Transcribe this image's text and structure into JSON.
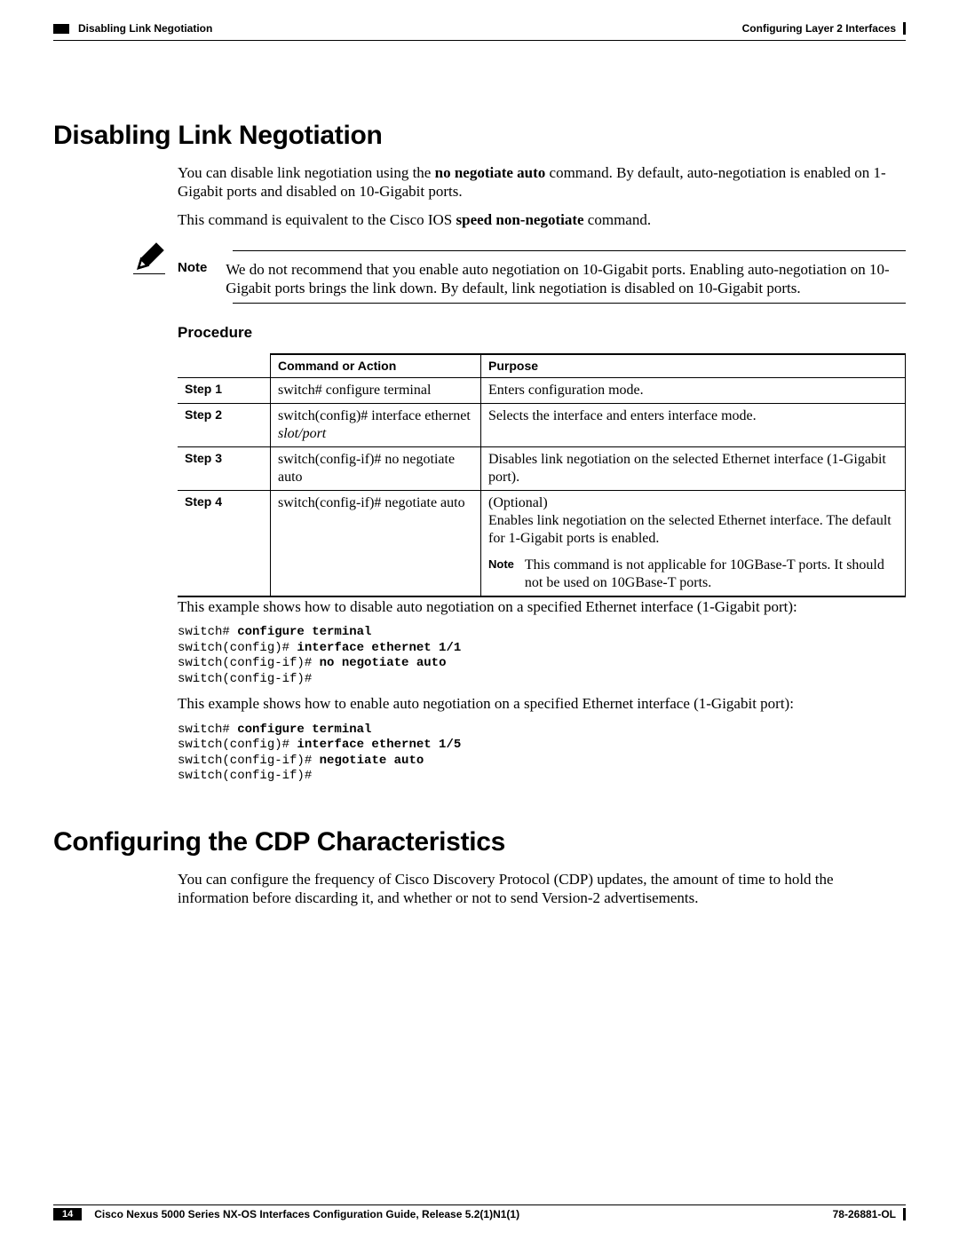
{
  "header": {
    "left_text": "Disabling Link Negotiation",
    "right_text": "Configuring Layer 2 Interfaces"
  },
  "section1": {
    "title": "Disabling Link Negotiation",
    "para1a": "You can disable link negotiation using the ",
    "para1b": "no negotiate auto",
    "para1c": " command. By default, auto-negotiation is enabled on 1-Gigabit ports and disabled on 10-Gigabit ports.",
    "para2a": "This command is equivalent to the Cisco IOS ",
    "para2b": "speed non-negotiate",
    "para2c": " command.",
    "note_label": "Note",
    "note_text": "We do not recommend that you enable auto negotiation on 10-Gigabit ports. Enabling auto-negotiation on 10-Gigabit ports brings the link down. By default, link negotiation is disabled on 10-Gigabit ports.",
    "procedure_head": "Procedure",
    "table": {
      "h1": "",
      "h2": "Command or Action",
      "h3": "Purpose",
      "rows": [
        {
          "step": "Step 1",
          "cmd": "switch# configure terminal",
          "purpose": "Enters configuration mode."
        },
        {
          "step": "Step 2",
          "cmd": "switch(config)# interface ethernet slot/port",
          "purpose": "Selects the interface and enters interface mode."
        },
        {
          "step": "Step 3",
          "cmd": "switch(config-if)# no negotiate auto",
          "purpose": "Disables link negotiation on the selected Ethernet interface (1-Gigabit port)."
        },
        {
          "step": "Step 4",
          "cmd": "switch(config-if)# negotiate auto",
          "purpose_a": "(Optional)",
          "purpose_b": "Enables link negotiation on the selected Ethernet interface. The default for 1-Gigabit ports is enabled.",
          "note_label": "Note",
          "note_text": "This command is not applicable for 10GBase-T ports. It should not be used on 10GBase-T ports."
        }
      ]
    },
    "example1_intro": "This example shows how to disable auto negotiation on a specified Ethernet interface (1-Gigabit port):",
    "example1": {
      "l1p": "switch# ",
      "l1c": "configure terminal",
      "l2p": "switch(config)# ",
      "l2c": "interface ethernet 1/1",
      "l3p": "switch(config-if)# ",
      "l3c": "no negotiate auto",
      "l4": "switch(config-if)#"
    },
    "example2_intro": "This example shows how to enable auto negotiation on a specified Ethernet interface (1-Gigabit port):",
    "example2": {
      "l1p": "switch# ",
      "l1c": "configure terminal",
      "l2p": "switch(config)# ",
      "l2c": "interface ethernet 1/5",
      "l3p": "switch(config-if)# ",
      "l3c": "negotiate auto",
      "l4": "switch(config-if)#"
    }
  },
  "section2": {
    "title": "Configuring the CDP Characteristics",
    "para": "You can configure the frequency of Cisco Discovery Protocol (CDP) updates, the amount of time to hold the information before discarding it, and whether or not to send Version-2 advertisements."
  },
  "footer": {
    "page": "14",
    "title": "Cisco Nexus 5000 Series NX-OS Interfaces Configuration Guide, Release 5.2(1)N1(1)",
    "docid": "78-26881-OL"
  }
}
